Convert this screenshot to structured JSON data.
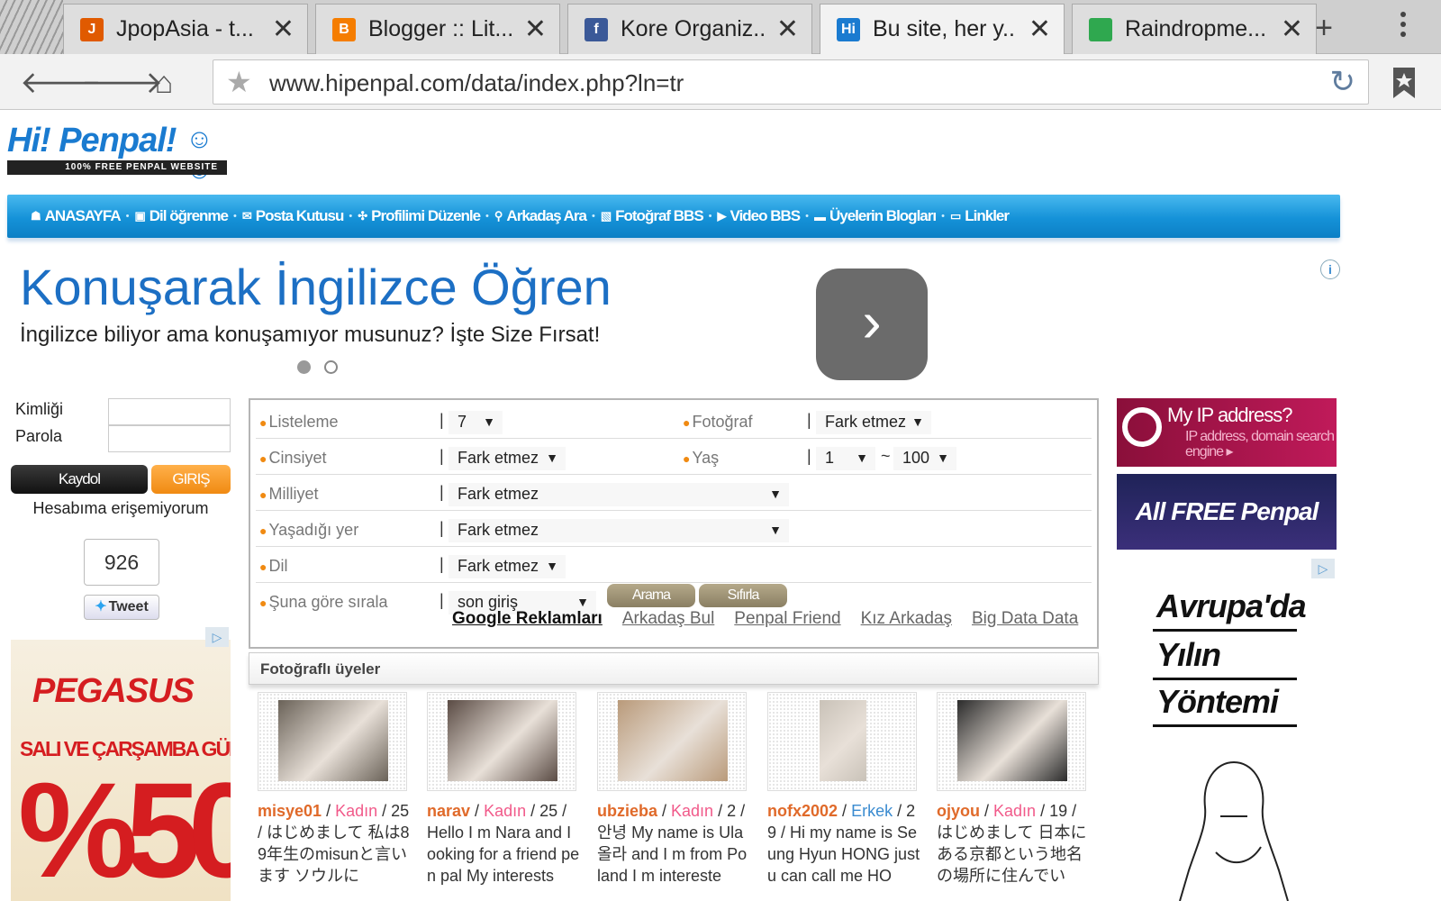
{
  "browser": {
    "tabs": [
      {
        "title": "JpopAsia - t...",
        "icon": "jpopasia-icon",
        "color": "#e05a00",
        "glyph": "J",
        "active": false
      },
      {
        "title": "Blogger :: Lit...",
        "icon": "blogger-icon",
        "color": "#f57d00",
        "glyph": "B",
        "active": false
      },
      {
        "title": "Kore Organiz...",
        "icon": "facebook-icon",
        "color": "#3b5998",
        "glyph": "f",
        "active": false
      },
      {
        "title": "Bu site, her y...",
        "icon": "hipenpal-icon",
        "color": "#1a7bd0",
        "glyph": "Hi",
        "active": true
      },
      {
        "title": "Raindropme...",
        "icon": "raindrop-icon",
        "color": "#2fa84f",
        "glyph": "",
        "active": false
      }
    ],
    "new_tab": "+",
    "url": "www.hipenpal.com/data/index.php?ln=tr"
  },
  "site": {
    "logo_title": "Hi! Penpal!",
    "logo_sub": "100% FREE PENPAL WEBSITE"
  },
  "menu": [
    {
      "label": "ANASAYFA",
      "icon": "home-icon",
      "glyph": "☗"
    },
    {
      "label": "Dil öğrenme",
      "icon": "language-icon",
      "glyph": "▣"
    },
    {
      "label": "Posta Kutusu",
      "icon": "mail-icon",
      "glyph": "✉"
    },
    {
      "label": "Profilimi Düzenle",
      "icon": "profile-edit-icon",
      "glyph": "✣"
    },
    {
      "label": "Arkadaş Ara",
      "icon": "search-icon",
      "glyph": "⚲"
    },
    {
      "label": "Fotoğraf BBS",
      "icon": "photo-icon",
      "glyph": "▧"
    },
    {
      "label": "Video BBS",
      "icon": "video-icon",
      "glyph": "▶"
    },
    {
      "label": "Üyelerin Blogları",
      "icon": "blog-icon",
      "glyph": "▬"
    },
    {
      "label": "Linkler",
      "icon": "links-icon",
      "glyph": "▭"
    }
  ],
  "ad_banner": {
    "title": "Konuşarak İngilizce Öğren",
    "description": "İngilizce biliyor ama konuşamıyor musunuz? İşte Size Fırsat!"
  },
  "login": {
    "id_label": "Kimliği",
    "password_label": "Parola",
    "register_label": "Kaydol",
    "login_label": "GIRIŞ",
    "forgot_label": "Hesabıma erişemiyorum",
    "tweet_count": "926",
    "tweet_label": "Tweet"
  },
  "left_ad": {
    "brand": "PEGASUS",
    "days": "SALI VE ÇARŞAMBA GÜNLERİ",
    "percent": "%50"
  },
  "search": {
    "list_label": "Listeleme",
    "list_value": "7",
    "photo_label": "Fotoğraf",
    "photo_value": "Fark etmez",
    "gender_label": "Cinsiyet",
    "gender_value": "Fark etmez",
    "age_label": "Yaş",
    "age_min": "1",
    "age_sep": "~",
    "age_max": "100",
    "nationality_label": "Milliyet",
    "nationality_value": "Fark etmez",
    "residence_label": "Yaşadığı yer",
    "residence_value": "Fark etmez",
    "language_label": "Dil",
    "language_value": "Fark etmez",
    "sort_label": "Şuna göre sırala",
    "sort_value": "son giriş",
    "search_button": "Arama",
    "reset_button": "Sıfırla",
    "ad_links": [
      "Google Reklamları",
      "Arkadaş Bul",
      "Penpal Friend",
      "Kız Arkadaş",
      "Big Data Data"
    ]
  },
  "photo_members": {
    "heading": "Fotoğraflı üyeler",
    "members": [
      {
        "name": "misye01",
        "gender": "Kadın",
        "gclass": "female",
        "rest": " / 25 / はじめまして 私は89年生のmisunと言います ソウルに",
        "tone": "#6a6258"
      },
      {
        "name": "narav",
        "gender": "Kadın",
        "gclass": "female",
        "rest": " / 25 / Hello I m Nara and I ooking for a friend pen pal My interests",
        "tone": "#5a4b44"
      },
      {
        "name": "ubzieba",
        "gender": "Kadın",
        "gclass": "female",
        "rest": " / 2 / 안녕 My name is Ula 올라 and I m from Poland I m intereste",
        "tone": "#b99a7a"
      },
      {
        "name": "nofx2002",
        "gender": "Erkek",
        "gclass": "male",
        "rest": " / 29 / Hi my name is Seung Hyun HONG just u can call me HO",
        "tone": "#c9c2b8"
      },
      {
        "name": "ojyou",
        "gender": "Kadın",
        "gclass": "female",
        "rest": " / 19 / はじめまして 日本にある京都という地名の場所に住んでい",
        "tone": "#2b2b2b"
      }
    ]
  },
  "right_ads": {
    "ip_title": "My IP address?",
    "ip_sub": "IP address, domain search engine ▸",
    "free_title": "All FREE Penpal",
    "euro_words": [
      "Avrupa'da",
      "Yılın",
      "Yöntemi"
    ]
  }
}
